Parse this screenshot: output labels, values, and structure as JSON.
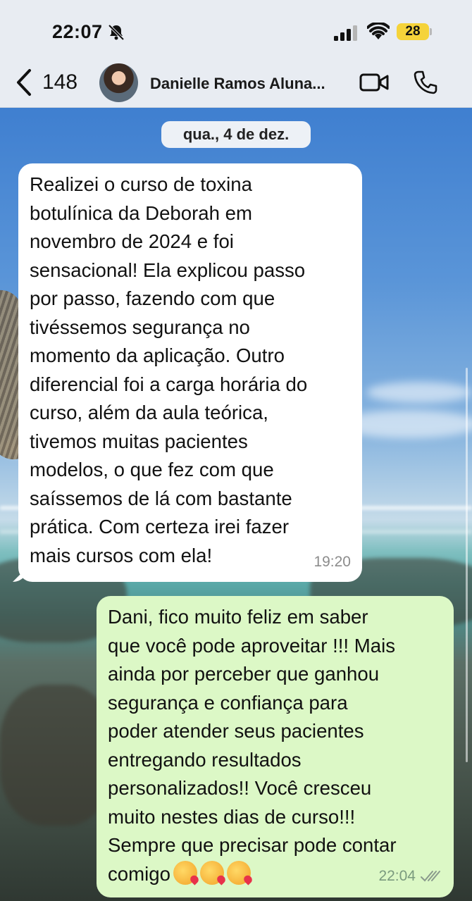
{
  "status_bar": {
    "time": "22:07",
    "battery": "28",
    "icons": [
      "bell-slash-icon",
      "cellular-signal-icon",
      "wifi-icon",
      "battery-icon"
    ]
  },
  "nav": {
    "back_count": "148",
    "contact_name": "Danielle Ramos  Aluna...",
    "icons": [
      "chevron-left-icon",
      "video-camera-icon",
      "phone-icon"
    ]
  },
  "chat": {
    "date_label": "qua., 4 de dez.",
    "messages": [
      {
        "direction": "incoming",
        "text": "Realizei o curso de toxina\nbotulínica da Deborah em\nnovembro de 2024 e foi\nsensacional! Ela explicou passo\npor passo, fazendo com que\ntivéssemos segurança no\nmomento da aplicação. Outro\ndiferencial foi a carga horária do\ncurso, além da aula teórica,\ntivemos muitas pacientes\nmodelos, o que fez com que\nsaíssemos de lá com bastante\nprática. Com certeza irei fazer\nmais cursos com ela!",
        "time": "19:20"
      },
      {
        "direction": "outgoing",
        "text": "Dani, fico muito feliz em saber\nque você pode aproveitar !!! Mais\nainda por perceber que ganhou\nsegurança e confiança  para\npoder atender seus pacientes\nentregando resultados\npersonalizados!! Você cresceu\nmuito nestes dias de curso!!!\nSempre que precisar pode contar\ncomigo",
        "emoji": [
          "face-blowing-kiss",
          "face-blowing-kiss",
          "face-blowing-kiss"
        ],
        "time": "22:04",
        "status": "read"
      }
    ]
  },
  "colors": {
    "header_bg": "#eceef4",
    "incoming_bubble": "#ffffff",
    "outgoing_bubble": "#dcf8c6",
    "battery": "#f5d33a"
  }
}
